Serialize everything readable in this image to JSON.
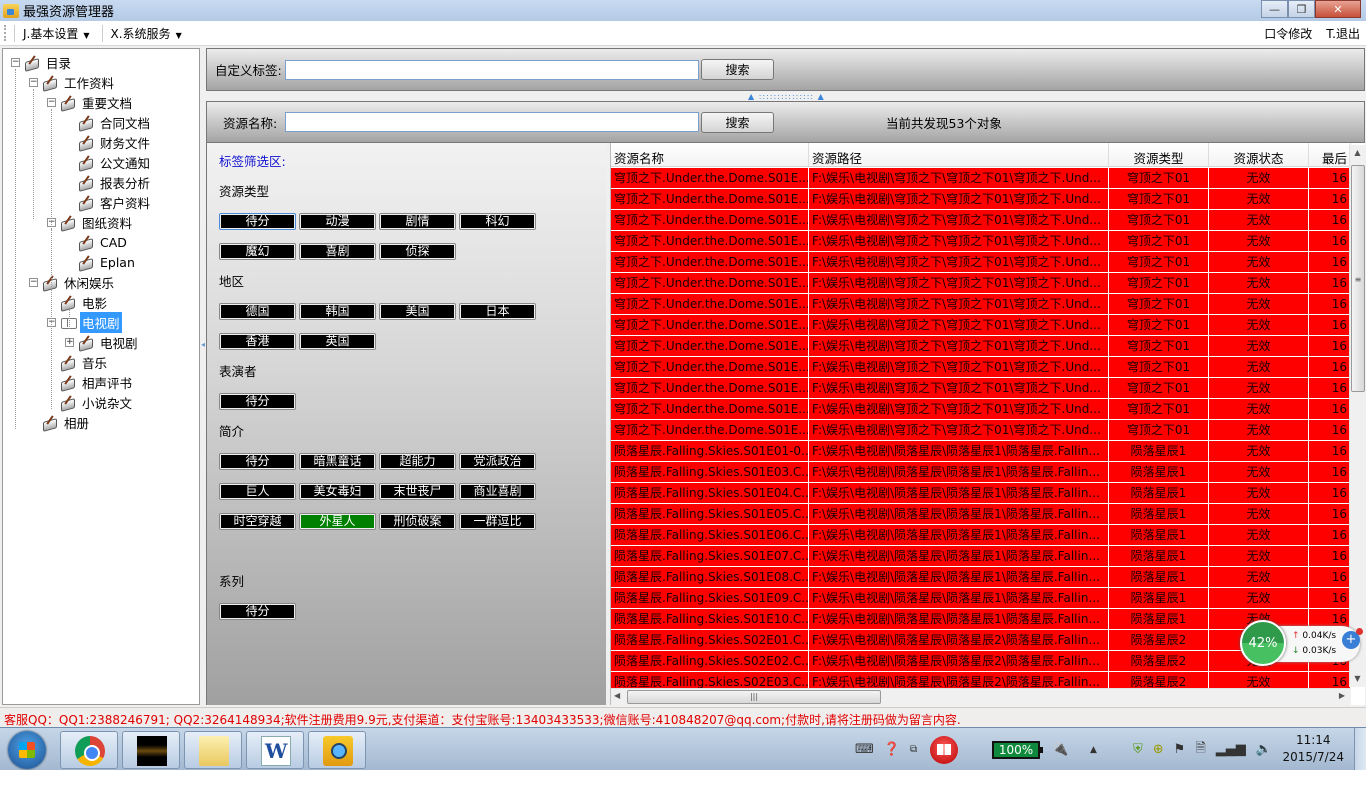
{
  "window": {
    "title": "最强资源管理器",
    "controls": {
      "minimize": "—",
      "maximize": "❐",
      "close": "✕"
    }
  },
  "menubar": {
    "items": [
      {
        "label": "J.基本设置",
        "has_dropdown": true
      },
      {
        "label": "X.系统服务",
        "has_dropdown": true
      }
    ],
    "right_items": [
      {
        "label": "口令修改"
      },
      {
        "label": "T.退出"
      }
    ]
  },
  "tree": {
    "nodes": [
      {
        "label": "目录",
        "level": 0,
        "expander": "minus",
        "icon": "pen-paper-icon"
      },
      {
        "label": "工作资料",
        "level": 1,
        "expander": "minus",
        "icon": "pen-paper-icon"
      },
      {
        "label": "重要文档",
        "level": 2,
        "expander": "minus",
        "icon": "pen-paper-icon"
      },
      {
        "label": "合同文档",
        "level": 3,
        "expander": null,
        "icon": "pen-paper-icon"
      },
      {
        "label": "财务文件",
        "level": 3,
        "expander": null,
        "icon": "pen-paper-icon"
      },
      {
        "label": "公文通知",
        "level": 3,
        "expander": null,
        "icon": "pen-paper-icon"
      },
      {
        "label": "报表分析",
        "level": 3,
        "expander": null,
        "icon": "pen-paper-icon"
      },
      {
        "label": "客户资料",
        "level": 3,
        "expander": null,
        "icon": "pen-paper-icon"
      },
      {
        "label": "图纸资料",
        "level": 2,
        "expander": "minus",
        "icon": "pen-paper-icon"
      },
      {
        "label": "CAD",
        "level": 3,
        "expander": null,
        "icon": "pen-paper-icon"
      },
      {
        "label": "Eplan",
        "level": 3,
        "expander": null,
        "icon": "pen-paper-icon"
      },
      {
        "label": "休闲娱乐",
        "level": 1,
        "expander": "minus",
        "icon": "pen-paper-icon"
      },
      {
        "label": "电影",
        "level": 2,
        "expander": null,
        "icon": "pen-paper-icon"
      },
      {
        "label": "电视剧",
        "level": 2,
        "expander": "minus",
        "icon": "open-book-icon",
        "selected": true
      },
      {
        "label": "电视剧",
        "level": 3,
        "expander": "plus",
        "icon": "pen-paper-icon"
      },
      {
        "label": "音乐",
        "level": 2,
        "expander": null,
        "icon": "pen-paper-icon"
      },
      {
        "label": "相声评书",
        "level": 2,
        "expander": null,
        "icon": "pen-paper-icon"
      },
      {
        "label": "小说杂文",
        "level": 2,
        "expander": null,
        "icon": "pen-paper-icon"
      },
      {
        "label": "相册",
        "level": 1,
        "expander": null,
        "icon": "pen-paper-icon"
      }
    ]
  },
  "tag_search": {
    "label": "自定义标签:",
    "value": "",
    "button": "搜索"
  },
  "name_search": {
    "label": "资源名称:",
    "value": "",
    "button": "搜索",
    "count_text": "当前共发现53个对象"
  },
  "filter": {
    "heading": "标签筛选区:",
    "sections": [
      {
        "title": "资源类型",
        "tags": [
          {
            "label": "待分",
            "focused": true
          },
          {
            "label": "动漫"
          },
          {
            "label": "剧情"
          },
          {
            "label": "科幻"
          },
          {
            "label": "魔幻"
          },
          {
            "label": "喜剧"
          },
          {
            "label": "侦探"
          }
        ]
      },
      {
        "title": "地区",
        "tags": [
          {
            "label": "德国"
          },
          {
            "label": "韩国"
          },
          {
            "label": "美国"
          },
          {
            "label": "日本"
          },
          {
            "label": "香港"
          },
          {
            "label": "英国"
          }
        ]
      },
      {
        "title": "表演者",
        "tags": [
          {
            "label": "待分"
          }
        ]
      },
      {
        "title": "简介",
        "tags": [
          {
            "label": "待分"
          },
          {
            "label": "暗黑童话"
          },
          {
            "label": "超能力"
          },
          {
            "label": "党派政治"
          },
          {
            "label": "巨人"
          },
          {
            "label": "美女毒妇"
          },
          {
            "label": "末世丧尸"
          },
          {
            "label": "商业喜剧"
          },
          {
            "label": "时空穿越"
          },
          {
            "label": "外星人",
            "active": true
          },
          {
            "label": "刑侦破案"
          },
          {
            "label": "一群逗比"
          }
        ]
      },
      {
        "title": "系列",
        "tags": [
          {
            "label": "待分"
          }
        ]
      }
    ],
    "active_color": "#008000"
  },
  "grid": {
    "columns": [
      "资源名称",
      "资源路径",
      "资源类型",
      "资源状态",
      "最后"
    ],
    "row_color": "#ff0000",
    "rows": [
      [
        "穹顶之下.Under.the.Dome.S01E...",
        "F:\\娱乐\\电视剧\\穹顶之下\\穹顶之下01\\穹顶之下.Und...",
        "穹顶之下01",
        "无效",
        "16"
      ],
      [
        "穹顶之下.Under.the.Dome.S01E...",
        "F:\\娱乐\\电视剧\\穹顶之下\\穹顶之下01\\穹顶之下.Und...",
        "穹顶之下01",
        "无效",
        "16"
      ],
      [
        "穹顶之下.Under.the.Dome.S01E...",
        "F:\\娱乐\\电视剧\\穹顶之下\\穹顶之下01\\穹顶之下.Und...",
        "穹顶之下01",
        "无效",
        "16"
      ],
      [
        "穹顶之下.Under.the.Dome.S01E...",
        "F:\\娱乐\\电视剧\\穹顶之下\\穹顶之下01\\穹顶之下.Und...",
        "穹顶之下01",
        "无效",
        "16"
      ],
      [
        "穹顶之下.Under.the.Dome.S01E...",
        "F:\\娱乐\\电视剧\\穹顶之下\\穹顶之下01\\穹顶之下.Und...",
        "穹顶之下01",
        "无效",
        "16"
      ],
      [
        "穹顶之下.Under.the.Dome.S01E...",
        "F:\\娱乐\\电视剧\\穹顶之下\\穹顶之下01\\穹顶之下.Und...",
        "穹顶之下01",
        "无效",
        "16"
      ],
      [
        "穹顶之下.Under.the.Dome.S01E...",
        "F:\\娱乐\\电视剧\\穹顶之下\\穹顶之下01\\穹顶之下.Und...",
        "穹顶之下01",
        "无效",
        "16"
      ],
      [
        "穹顶之下.Under.the.Dome.S01E...",
        "F:\\娱乐\\电视剧\\穹顶之下\\穹顶之下01\\穹顶之下.Und...",
        "穹顶之下01",
        "无效",
        "16"
      ],
      [
        "穹顶之下.Under.the.Dome.S01E...",
        "F:\\娱乐\\电视剧\\穹顶之下\\穹顶之下01\\穹顶之下.Und...",
        "穹顶之下01",
        "无效",
        "16"
      ],
      [
        "穹顶之下.Under.the.Dome.S01E...",
        "F:\\娱乐\\电视剧\\穹顶之下\\穹顶之下01\\穹顶之下.Und...",
        "穹顶之下01",
        "无效",
        "16"
      ],
      [
        "穹顶之下.Under.the.Dome.S01E...",
        "F:\\娱乐\\电视剧\\穹顶之下\\穹顶之下01\\穹顶之下.Und...",
        "穹顶之下01",
        "无效",
        "16"
      ],
      [
        "穹顶之下.Under.the.Dome.S01E...",
        "F:\\娱乐\\电视剧\\穹顶之下\\穹顶之下01\\穹顶之下.Und...",
        "穹顶之下01",
        "无效",
        "16"
      ],
      [
        "穹顶之下.Under.the.Dome.S01E...",
        "F:\\娱乐\\电视剧\\穹顶之下\\穹顶之下01\\穹顶之下.Und...",
        "穹顶之下01",
        "无效",
        "16"
      ],
      [
        "陨落星辰.Falling.Skies.S01E01-0...",
        "F:\\娱乐\\电视剧\\陨落星辰\\陨落星辰1\\陨落星辰.Fallin...",
        "陨落星辰1",
        "无效",
        "16"
      ],
      [
        "陨落星辰.Falling.Skies.S01E03.C...",
        "F:\\娱乐\\电视剧\\陨落星辰\\陨落星辰1\\陨落星辰.Fallin...",
        "陨落星辰1",
        "无效",
        "16"
      ],
      [
        "陨落星辰.Falling.Skies.S01E04.C...",
        "F:\\娱乐\\电视剧\\陨落星辰\\陨落星辰1\\陨落星辰.Fallin...",
        "陨落星辰1",
        "无效",
        "16"
      ],
      [
        "陨落星辰.Falling.Skies.S01E05.C...",
        "F:\\娱乐\\电视剧\\陨落星辰\\陨落星辰1\\陨落星辰.Fallin...",
        "陨落星辰1",
        "无效",
        "16"
      ],
      [
        "陨落星辰.Falling.Skies.S01E06.C...",
        "F:\\娱乐\\电视剧\\陨落星辰\\陨落星辰1\\陨落星辰.Fallin...",
        "陨落星辰1",
        "无效",
        "16"
      ],
      [
        "陨落星辰.Falling.Skies.S01E07.C...",
        "F:\\娱乐\\电视剧\\陨落星辰\\陨落星辰1\\陨落星辰.Fallin...",
        "陨落星辰1",
        "无效",
        "16"
      ],
      [
        "陨落星辰.Falling.Skies.S01E08.C...",
        "F:\\娱乐\\电视剧\\陨落星辰\\陨落星辰1\\陨落星辰.Fallin...",
        "陨落星辰1",
        "无效",
        "16"
      ],
      [
        "陨落星辰.Falling.Skies.S01E09.C...",
        "F:\\娱乐\\电视剧\\陨落星辰\\陨落星辰1\\陨落星辰.Fallin...",
        "陨落星辰1",
        "无效",
        "16"
      ],
      [
        "陨落星辰.Falling.Skies.S01E10.C...",
        "F:\\娱乐\\电视剧\\陨落星辰\\陨落星辰1\\陨落星辰.Fallin...",
        "陨落星辰1",
        "无效",
        "16"
      ],
      [
        "陨落星辰.Falling.Skies.S02E01.C...",
        "F:\\娱乐\\电视剧\\陨落星辰\\陨落星辰2\\陨落星辰.Fallin...",
        "陨落星辰2",
        "无效",
        "16"
      ],
      [
        "陨落星辰.Falling.Skies.S02E02.C...",
        "F:\\娱乐\\电视剧\\陨落星辰\\陨落星辰2\\陨落星辰.Fallin...",
        "陨落星辰2",
        "无效",
        "16"
      ],
      [
        "陨落星辰.Falling.Skies.S02E03.C...",
        "F:\\娱乐\\电视剧\\陨落星辰\\陨落星辰2\\陨落星辰.Fallin...",
        "陨落星辰2",
        "无效",
        "16"
      ]
    ]
  },
  "net_widget": {
    "percent": "42%",
    "upload": "0.04K/s",
    "download": "0.03K/s"
  },
  "statusbar": {
    "text": "客服QQ：QQ1:2388246791; QQ2:3264148934;软件注册费用9.9元,支付渠道：支付宝账号:13403433533;微信账号:410848207@qq.com;付款时,请将注册码做为留言内容."
  },
  "taskbar": {
    "apps": [
      "chrome-icon",
      "photo-viewer-icon",
      "file-explorer-icon",
      "word-icon",
      "resource-manager-icon"
    ],
    "battery": "100%",
    "time": "11:14",
    "date": "2015/7/24"
  }
}
